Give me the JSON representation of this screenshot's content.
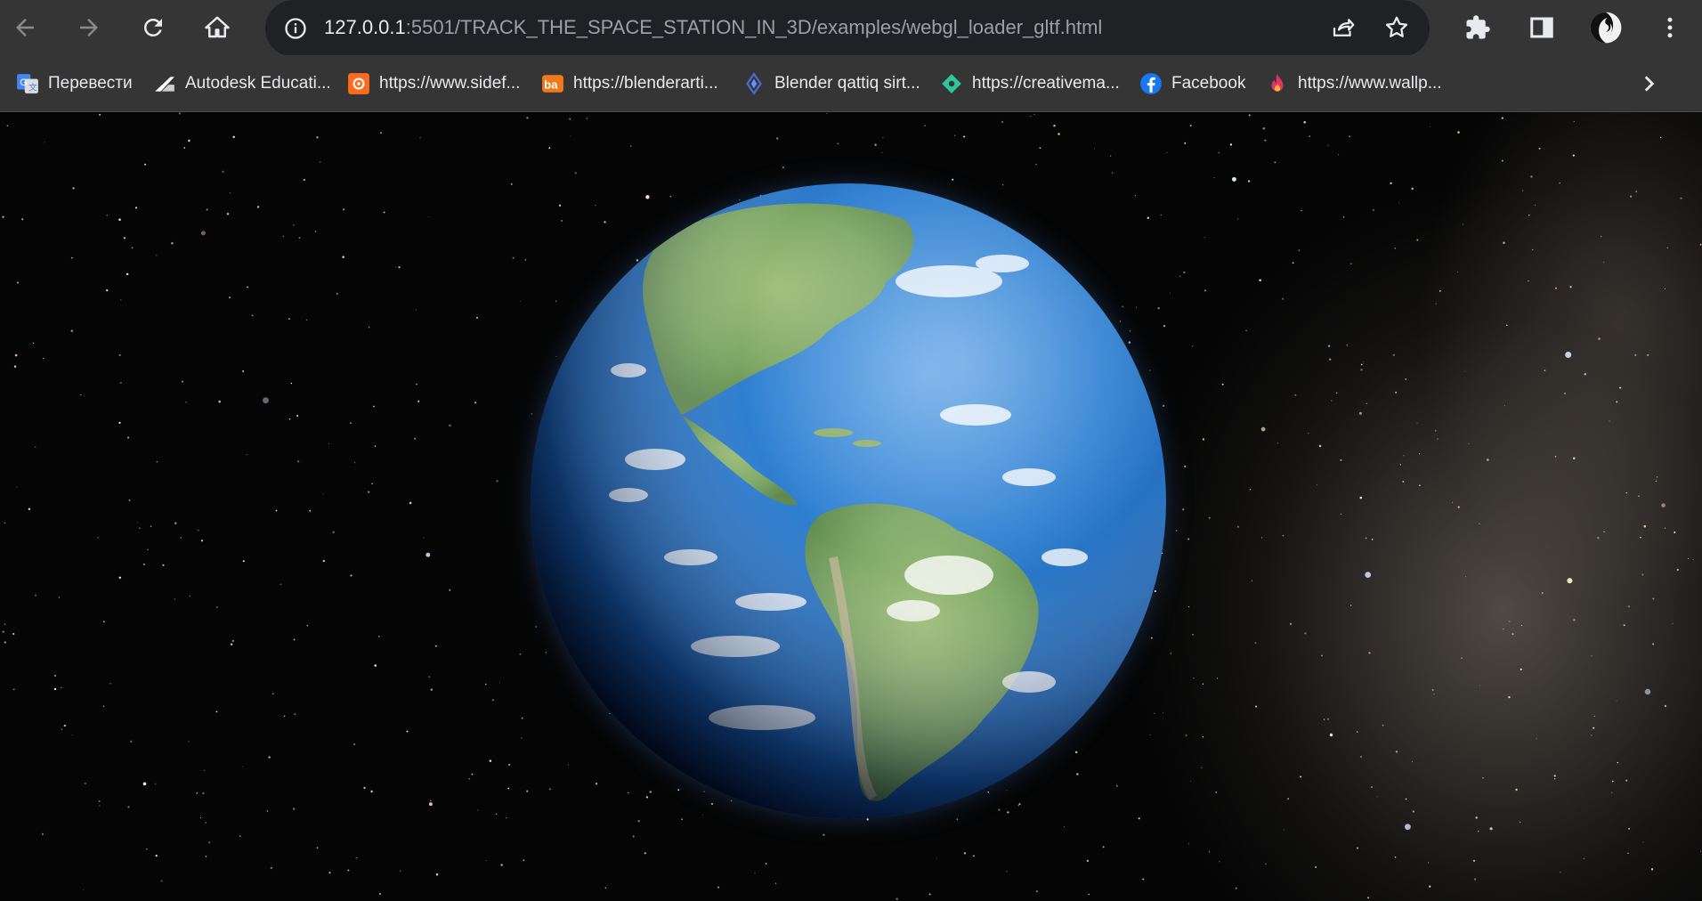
{
  "browser": {
    "url_host": "127.0.0.1",
    "url_rest": ":5501/TRACK_THE_SPACE_STATION_IN_3D/examples/webgl_loader_gltf.html",
    "icons": {
      "back": "back-arrow-icon",
      "forward": "forward-arrow-icon",
      "reload": "reload-icon",
      "home": "home-icon",
      "site_info": "info-icon",
      "share": "share-icon",
      "bookmark": "star-icon",
      "extensions": "puzzle-icon",
      "side_panel": "side-panel-icon",
      "profile": "avatar",
      "menu": "kebab-menu-icon"
    }
  },
  "bookmarks": [
    {
      "label": "Перевести",
      "icon": "google-translate-icon",
      "color": "#4285f4"
    },
    {
      "label": "Autodesk Educati...",
      "icon": "autodesk-icon",
      "color": "#ffffff"
    },
    {
      "label": "https://www.sidef...",
      "icon": "houdini-icon",
      "color": "#ff6a1f"
    },
    {
      "label": "https://blenderarti...",
      "icon": "blenderartists-icon",
      "color": "#f07a1a"
    },
    {
      "label": "Blender qattiq sirt...",
      "icon": "blender-diamond-icon",
      "color": "#4a6ad8"
    },
    {
      "label": "https://creativema...",
      "icon": "creativemarket-icon",
      "color": "#2cc79a"
    },
    {
      "label": "Facebook",
      "icon": "facebook-icon",
      "color": "#1877f2"
    },
    {
      "label": "https://www.wallp...",
      "icon": "flame-icon",
      "color": "#e0336b"
    }
  ],
  "scene": {
    "subject": "earth-globe",
    "background": "starfield"
  }
}
